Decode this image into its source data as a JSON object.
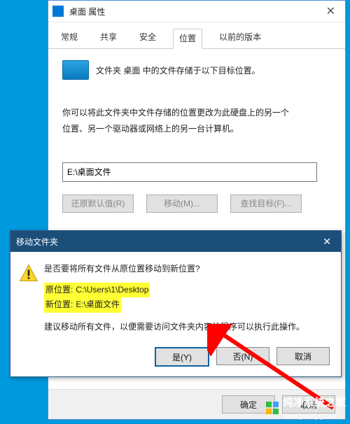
{
  "propwin": {
    "title": "桌面 属性",
    "tabs": [
      "常规",
      "共享",
      "安全",
      "位置",
      "以前的版本"
    ],
    "active_tab_index": 3,
    "folder_line": "文件夹 桌面 中的文件存储于以下目标位置。",
    "para_line1": "你可以将此文件夹中文件存储的位置更改为此硬盘上的另一个",
    "para_line2": "位置、另一个驱动器或网络上的另一台计算机。",
    "path_value": "E:\\桌面文件",
    "buttons": {
      "restore": "还原默认值(R)",
      "move": "移动(M)...",
      "find": "查找目标(F)..."
    },
    "footer": {
      "ok": "确定",
      "cancel": "取消"
    }
  },
  "modal": {
    "title": "移动文件夹",
    "question": "是否要将所有文件从原位置移动到新位置?",
    "orig_label": "原位置: ",
    "orig_value": "C:\\Users\\1\\Desktop",
    "new_label": "新位置: ",
    "new_value": "E:\\桌面文件",
    "advice": "建议移动所有文件，以便需要访问文件夹内容的程序可以执行此操作。",
    "buttons": {
      "yes": "是(Y)",
      "no": "否(N)",
      "cancel": "取消"
    }
  },
  "watermark": {
    "text": "纯净系统之家",
    "url": "www.ycwnjzy.com"
  }
}
